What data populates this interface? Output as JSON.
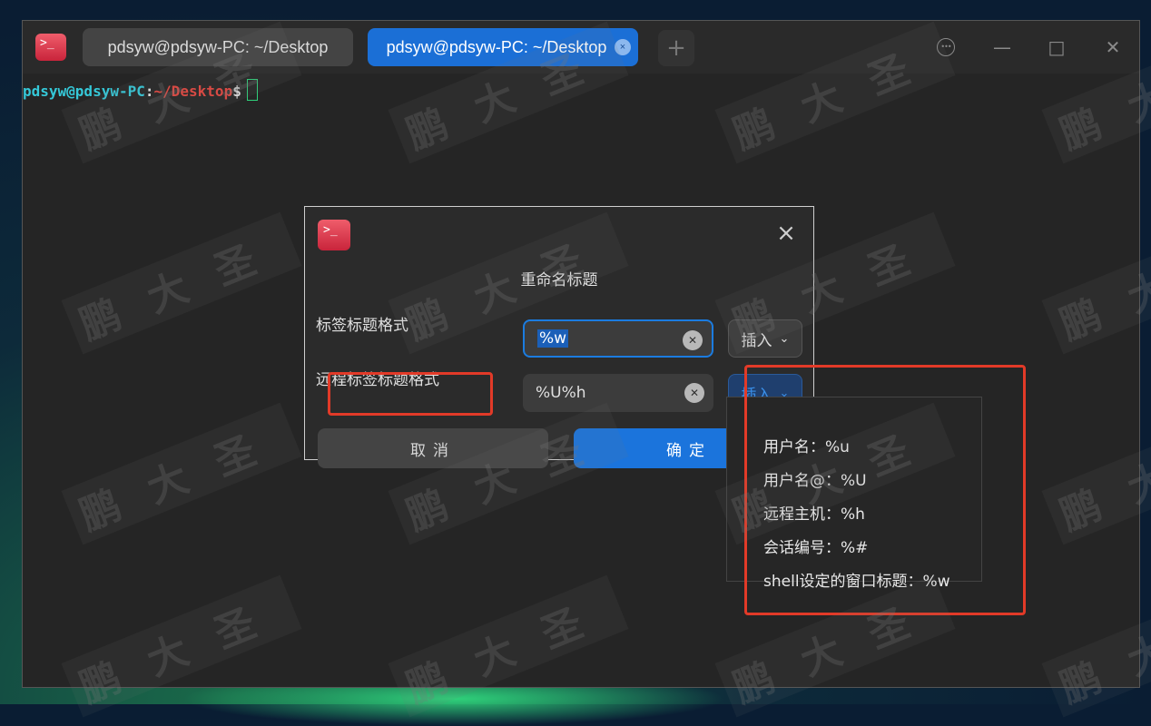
{
  "window": {
    "app_icon_glyph": ">_",
    "tabs": [
      {
        "label": "pdsyw@pdsyw-PC: ~/Desktop",
        "active": false
      },
      {
        "label": "pdsyw@pdsyw-PC: ~/Desktop",
        "active": true
      }
    ],
    "tab_close_glyph": "×",
    "add_tab_glyph": "+",
    "controls": {
      "menu": "•••",
      "minimize": "—",
      "maximize": "□",
      "close": "✕"
    }
  },
  "terminal": {
    "prompt_user": "pdsyw@pdsyw-PC",
    "prompt_colon": ":",
    "prompt_dir": "~/Desktop",
    "prompt_symbol": "$"
  },
  "dialog": {
    "icon_glyph": ">_",
    "close_glyph": "×",
    "title": "重命名标题",
    "tab_title_label": "标签标题格式",
    "tab_title_value": "%w",
    "remote_title_label": "远程标签标题格式",
    "remote_title_value": "%U%h",
    "clear_glyph": "✕",
    "insert_label": "插入",
    "chevron_glyph": "⌄",
    "cancel_label": "取消",
    "ok_label": "确定"
  },
  "dropdown": {
    "items": [
      "用户名：%u",
      "用户名@：%U",
      "远程主机：%h",
      "会话编号：%#",
      "shell设定的窗口标题：%w"
    ]
  },
  "watermark": {
    "text": "鹏大圣"
  },
  "colors": {
    "accent": "#1b74dc",
    "highlight": "#e23a28",
    "prompt_user": "#35c8d8",
    "prompt_dir": "#e4463f",
    "cursor": "#2fd07a"
  }
}
